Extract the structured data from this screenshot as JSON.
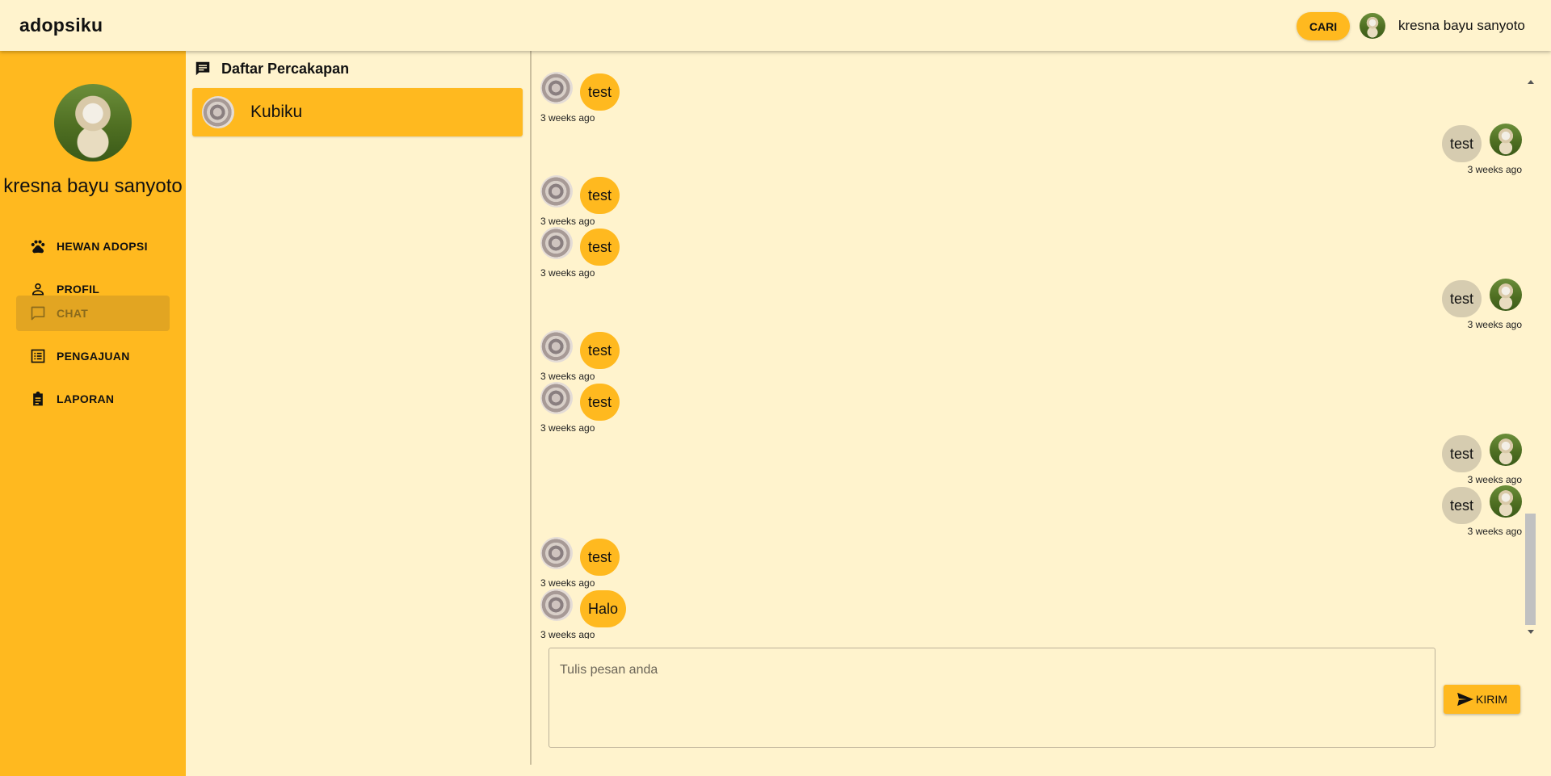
{
  "app": {
    "title": "adopsiku"
  },
  "header": {
    "search_label": "CARI",
    "user_name": "kresna bayu sanyoto"
  },
  "sidebar": {
    "user_name": "kresna bayu sanyoto",
    "items": [
      {
        "label": "HEWAN ADOPSI",
        "icon": "paw-icon",
        "active": false
      },
      {
        "label": "PROFIL",
        "icon": "person-icon",
        "active": false
      },
      {
        "label": "CHAT",
        "icon": "chat-bubble-icon",
        "active": true
      },
      {
        "label": "PENGAJUAN",
        "icon": "list-icon",
        "active": false
      },
      {
        "label": "LAPORAN",
        "icon": "clipboard-icon",
        "active": false
      }
    ]
  },
  "conversations": {
    "title": "Daftar Percakapan",
    "items": [
      {
        "name": "Kubiku",
        "selected": true
      }
    ]
  },
  "messages": [
    {
      "direction": "in",
      "text": "test",
      "time": "3 weeks ago"
    },
    {
      "direction": "out",
      "text": "test",
      "time": "3 weeks ago"
    },
    {
      "direction": "in",
      "text": "test",
      "time": "3 weeks ago"
    },
    {
      "direction": "in",
      "text": "test",
      "time": "3 weeks ago"
    },
    {
      "direction": "out",
      "text": "test",
      "time": "3 weeks ago"
    },
    {
      "direction": "in",
      "text": "test",
      "time": "3 weeks ago"
    },
    {
      "direction": "in",
      "text": "test",
      "time": "3 weeks ago"
    },
    {
      "direction": "out",
      "text": "test",
      "time": "3 weeks ago"
    },
    {
      "direction": "out",
      "text": "test",
      "time": "3 weeks ago"
    },
    {
      "direction": "in",
      "text": "test",
      "time": "3 weeks ago"
    },
    {
      "direction": "in",
      "text": "Halo",
      "time": "3 weeks ago"
    }
  ],
  "composer": {
    "placeholder": "Tulis pesan anda",
    "value": "",
    "send_label": "KIRIM"
  },
  "colors": {
    "accent": "#ffb91f",
    "background": "#fff3cd",
    "outgoing_bubble": "#d6ccb0",
    "active_nav": "#e2a522"
  }
}
